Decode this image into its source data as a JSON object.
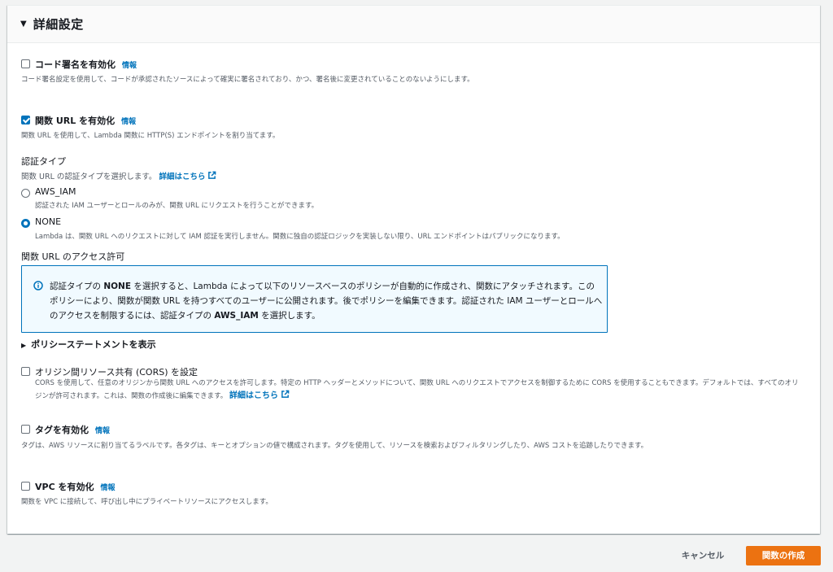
{
  "panel": {
    "title": "詳細設定"
  },
  "code_signing": {
    "label": "コード署名を有効化",
    "info": "情報",
    "description": "コード署名設定を使用して、コードが承認されたソースによって確実に署名されており、かつ、署名後に変更されていることのないようにします。",
    "checked": false
  },
  "function_url": {
    "label": "関数 URL を有効化",
    "info": "情報",
    "description": "関数 URL を使用して、Lambda 関数に HTTP(S) エンドポイントを割り当てます。",
    "checked": true
  },
  "auth_type": {
    "label": "認証タイプ",
    "description": "関数 URL の認証タイプを選択します。",
    "link": "詳細はこちら",
    "options": [
      {
        "label": "AWS_IAM",
        "description": "認証された IAM ユーザーとロールのみが、関数 URL にリクエストを行うことができます。",
        "selected": false
      },
      {
        "label": "NONE",
        "description": "Lambda は、関数 URL へのリクエストに対して IAM 認証を実行しません。関数に独自の認証ロジックを実装しない限り、URL エンドポイントはパブリックになります。",
        "selected": true
      }
    ]
  },
  "access_permission": {
    "label": "関数 URL のアクセス許可",
    "alert_part1": "認証タイプの ",
    "alert_bold1": "NONE",
    "alert_part2": " を選択すると、Lambda によって以下のリソースベースのポリシーが自動的に作成され、関数にアタッチされます。このポリシーにより、関数が関数 URL を持つすべてのユーザーに公開されます。後でポリシーを編集できます。認証された IAM ユーザーとロールへのアクセスを制限するには、認証タイプの ",
    "alert_bold2": "AWS_IAM",
    "alert_part3": " を選択します。"
  },
  "policy_expander": {
    "label": "ポリシーステートメントを表示"
  },
  "cors": {
    "label": "オリジン間リソース共有 (CORS) を設定",
    "description": "CORS を使用して、任意のオリジンから関数 URL へのアクセスを許可します。特定の HTTP ヘッダーとメソッドについて、関数 URL へのリクエストでアクセスを制御するために CORS を使用することもできます。デフォルトでは、すべてのオリジンが許可されます。これは、関数の作成後に編集できます。",
    "link": "詳細はこちら",
    "checked": false
  },
  "tags": {
    "label": "タグを有効化",
    "info": "情報",
    "description": "タグは、AWS リソースに割り当てるラベルです。各タグは、キーとオプションの値で構成されます。タグを使用して、リソースを検索およびフィルタリングしたり、AWS コストを追跡したりできます。",
    "checked": false
  },
  "vpc": {
    "label": "VPC を有効化",
    "info": "情報",
    "description": "関数を VPC に接続して、呼び出し中にプライベートリソースにアクセスします。",
    "checked": false
  },
  "footer": {
    "cancel": "キャンセル",
    "create": "関数の作成"
  },
  "colors": {
    "accent": "#0073bb",
    "primary_button": "#ec7211",
    "alert_bg": "#f1faff"
  },
  "icons": {
    "info": "info-circle-icon",
    "external": "external-link-icon",
    "expand": "caret-down-icon"
  }
}
